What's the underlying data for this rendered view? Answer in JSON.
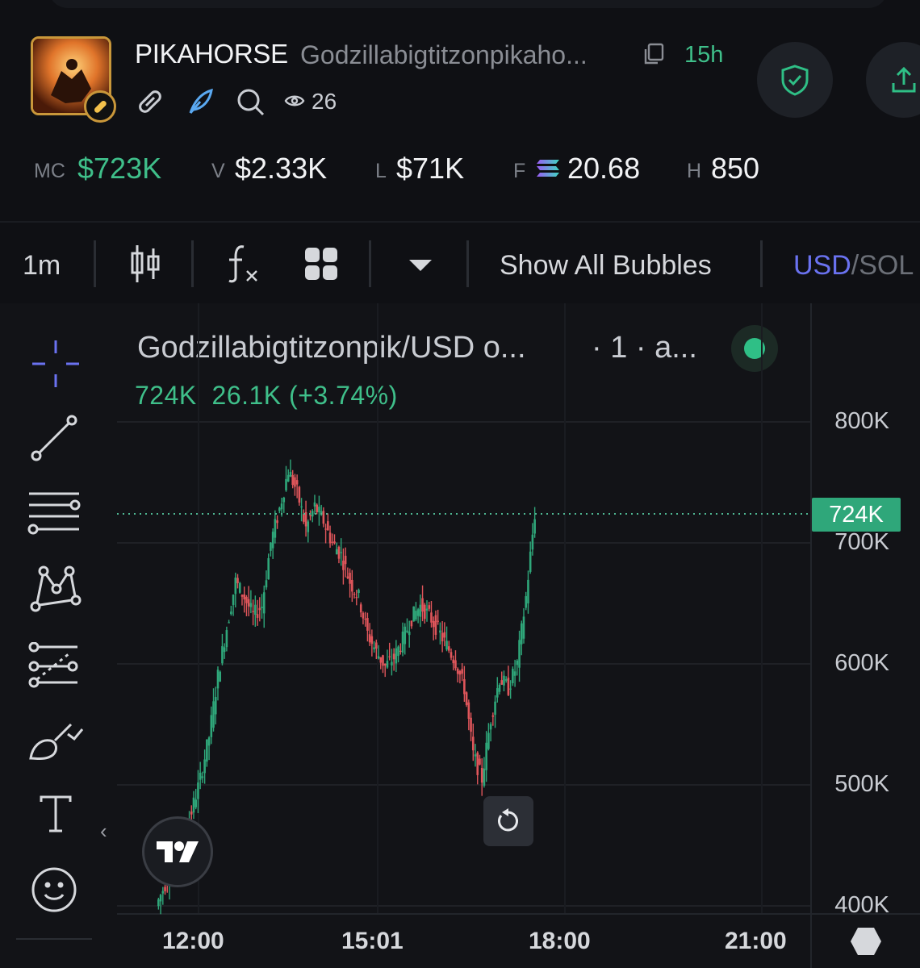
{
  "token": {
    "ticker": "PIKAHORSE",
    "name": "Godzillabigtitzonpikaho...",
    "age": "15h",
    "views": "26"
  },
  "stats": [
    {
      "label": "MC",
      "value": "$723K"
    },
    {
      "label": "V",
      "value": "$2.33K"
    },
    {
      "label": "L",
      "value": "$71K"
    },
    {
      "label": "F",
      "value": "20.68"
    },
    {
      "label": "H",
      "value": "850"
    }
  ],
  "toolbar": {
    "interval": "1m",
    "bubbles": "Show All Bubbles",
    "currency_active": "USD",
    "currency_sep": "/",
    "currency_other": "SOL"
  },
  "chart": {
    "symbol": "Godzillabigtitzonpik/USD o...",
    "meta": "· 1 · a...",
    "ohlc_value": "724K",
    "ohlc_change": "26.1K (+3.74%)",
    "current_price_label": "724K",
    "y_labels": [
      "800K",
      "700K",
      "600K",
      "500K",
      "400K"
    ],
    "x_labels": [
      "12:00",
      "15:01",
      "18:00",
      "21:00"
    ]
  },
  "colors": {
    "up": "#2fa77a",
    "down": "#e0565b",
    "accent": "#6a72f0"
  },
  "chart_data": {
    "type": "line",
    "series": [
      {
        "values": [
          400,
          418,
          432,
          452,
          478,
          505,
          540,
          590,
          630,
          668,
          655,
          640,
          648,
          700,
          728,
          760,
          742,
          712,
          730,
          718,
          700,
          690,
          668,
          655,
          625,
          610,
          598,
          605,
          620,
          638,
          648,
          640,
          628,
          615,
          602,
          580,
          525,
          505,
          555,
          588,
          580,
          600,
          655,
          724
        ]
      }
    ],
    "ylim": [
      400,
      800
    ],
    "current_value": 724
  }
}
